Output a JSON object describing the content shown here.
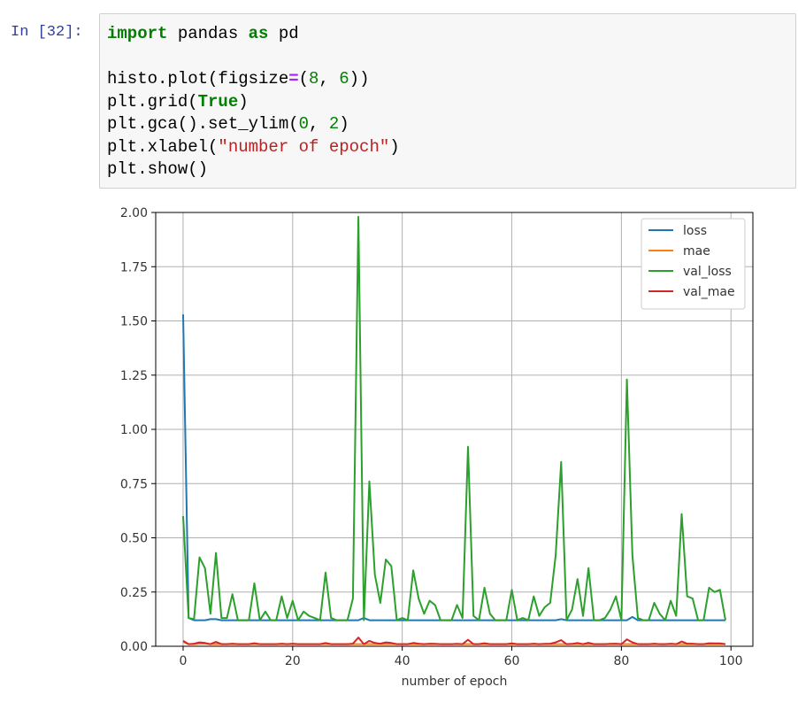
{
  "cell": {
    "prompt": "In [32]:",
    "code": {
      "kw_import": "import",
      "pandas": " pandas ",
      "kw_as": "as",
      "pd": " pd",
      "l3a": "histo.plot(figsize",
      "eq": "=",
      "l3b": "(",
      "n8": "8",
      "l3c": ", ",
      "n6": "6",
      "l3d": "))",
      "l4a": "plt.grid(",
      "true_kw": "True",
      "l4b": ")",
      "l5a": "plt.gca().set_ylim(",
      "n0": "0",
      "l5b": ", ",
      "n2": "2",
      "l5c": ")",
      "l6a": "plt.xlabel(",
      "str_xlabel": "\"number of epoch\"",
      "l6b": ")",
      "l7": "plt.show()"
    }
  },
  "colors": {
    "loss": "#1f77b4",
    "mae": "#ff7f0e",
    "val_loss": "#2ca02c",
    "val_mae": "#d62728",
    "grid": "#b0b0b0"
  },
  "chart_data": {
    "type": "line",
    "xlabel": "number of epoch",
    "ylabel": "",
    "title": "",
    "xlim": [
      -5,
      104
    ],
    "ylim": [
      0,
      2
    ],
    "xticks": [
      0,
      20,
      40,
      60,
      80,
      100
    ],
    "yticks": [
      0.0,
      0.25,
      0.5,
      0.75,
      1.0,
      1.25,
      1.5,
      1.75,
      2.0
    ],
    "ytick_labels": [
      "0.00",
      "0.25",
      "0.50",
      "0.75",
      "1.00",
      "1.25",
      "1.50",
      "1.75",
      "2.00"
    ],
    "grid": true,
    "legend_position": "top-right",
    "x": [
      0,
      1,
      2,
      3,
      4,
      5,
      6,
      7,
      8,
      9,
      10,
      11,
      12,
      13,
      14,
      15,
      16,
      17,
      18,
      19,
      20,
      21,
      22,
      23,
      24,
      25,
      26,
      27,
      28,
      29,
      30,
      31,
      32,
      33,
      34,
      35,
      36,
      37,
      38,
      39,
      40,
      41,
      42,
      43,
      44,
      45,
      46,
      47,
      48,
      49,
      50,
      51,
      52,
      53,
      54,
      55,
      56,
      57,
      58,
      59,
      60,
      61,
      62,
      63,
      64,
      65,
      66,
      67,
      68,
      69,
      70,
      71,
      72,
      73,
      74,
      75,
      76,
      77,
      78,
      79,
      80,
      81,
      82,
      83,
      84,
      85,
      86,
      87,
      88,
      89,
      90,
      91,
      92,
      93,
      94,
      95,
      96,
      97,
      98,
      99
    ],
    "series": [
      {
        "name": "loss",
        "values": [
          1.53,
          0.13,
          0.12,
          0.12,
          0.12,
          0.125,
          0.125,
          0.12,
          0.12,
          0.12,
          0.12,
          0.12,
          0.12,
          0.12,
          0.12,
          0.12,
          0.12,
          0.12,
          0.12,
          0.12,
          0.12,
          0.12,
          0.12,
          0.12,
          0.12,
          0.12,
          0.12,
          0.12,
          0.12,
          0.12,
          0.12,
          0.12,
          0.12,
          0.13,
          0.12,
          0.12,
          0.12,
          0.12,
          0.12,
          0.12,
          0.12,
          0.12,
          0.12,
          0.12,
          0.12,
          0.12,
          0.12,
          0.12,
          0.12,
          0.12,
          0.12,
          0.12,
          0.12,
          0.12,
          0.12,
          0.12,
          0.12,
          0.12,
          0.12,
          0.12,
          0.12,
          0.12,
          0.12,
          0.12,
          0.12,
          0.12,
          0.12,
          0.12,
          0.12,
          0.125,
          0.12,
          0.12,
          0.12,
          0.12,
          0.12,
          0.12,
          0.12,
          0.12,
          0.12,
          0.12,
          0.12,
          0.12,
          0.135,
          0.12,
          0.12,
          0.12,
          0.12,
          0.12,
          0.12,
          0.12,
          0.12,
          0.12,
          0.12,
          0.12,
          0.12,
          0.12,
          0.12,
          0.12,
          0.12,
          0.12
        ]
      },
      {
        "name": "mae",
        "values": [
          0.02,
          0.01,
          0.01,
          0.012,
          0.012,
          0.01,
          0.01,
          0.01,
          0.01,
          0.01,
          0.01,
          0.01,
          0.01,
          0.01,
          0.01,
          0.01,
          0.01,
          0.01,
          0.01,
          0.01,
          0.01,
          0.01,
          0.01,
          0.01,
          0.01,
          0.01,
          0.01,
          0.01,
          0.01,
          0.01,
          0.01,
          0.01,
          0.01,
          0.01,
          0.01,
          0.01,
          0.01,
          0.01,
          0.01,
          0.01,
          0.01,
          0.01,
          0.01,
          0.01,
          0.01,
          0.01,
          0.01,
          0.01,
          0.01,
          0.01,
          0.01,
          0.01,
          0.01,
          0.01,
          0.01,
          0.01,
          0.01,
          0.01,
          0.01,
          0.01,
          0.01,
          0.01,
          0.01,
          0.01,
          0.01,
          0.01,
          0.01,
          0.01,
          0.01,
          0.01,
          0.01,
          0.01,
          0.01,
          0.01,
          0.01,
          0.01,
          0.01,
          0.01,
          0.01,
          0.01,
          0.01,
          0.01,
          0.01,
          0.01,
          0.01,
          0.01,
          0.01,
          0.01,
          0.01,
          0.01,
          0.01,
          0.01,
          0.01,
          0.01,
          0.01,
          0.01,
          0.01,
          0.01,
          0.01,
          0.01
        ]
      },
      {
        "name": "val_loss",
        "values": [
          0.6,
          0.13,
          0.125,
          0.41,
          0.36,
          0.15,
          0.43,
          0.13,
          0.13,
          0.24,
          0.12,
          0.12,
          0.12,
          0.29,
          0.12,
          0.16,
          0.12,
          0.12,
          0.23,
          0.13,
          0.21,
          0.12,
          0.16,
          0.14,
          0.13,
          0.12,
          0.34,
          0.13,
          0.12,
          0.12,
          0.12,
          0.22,
          1.98,
          0.12,
          0.76,
          0.33,
          0.2,
          0.4,
          0.37,
          0.12,
          0.13,
          0.12,
          0.35,
          0.22,
          0.15,
          0.21,
          0.19,
          0.12,
          0.12,
          0.12,
          0.19,
          0.13,
          0.92,
          0.14,
          0.12,
          0.27,
          0.15,
          0.12,
          0.12,
          0.12,
          0.26,
          0.12,
          0.13,
          0.12,
          0.23,
          0.14,
          0.18,
          0.2,
          0.42,
          0.85,
          0.12,
          0.17,
          0.31,
          0.14,
          0.36,
          0.12,
          0.12,
          0.13,
          0.17,
          0.23,
          0.12,
          1.23,
          0.42,
          0.13,
          0.12,
          0.12,
          0.2,
          0.15,
          0.12,
          0.21,
          0.14,
          0.61,
          0.23,
          0.22,
          0.12,
          0.12,
          0.27,
          0.25,
          0.26,
          0.12
        ]
      },
      {
        "name": "val_mae",
        "values": [
          0.025,
          0.01,
          0.012,
          0.018,
          0.015,
          0.01,
          0.02,
          0.01,
          0.01,
          0.012,
          0.01,
          0.01,
          0.01,
          0.014,
          0.01,
          0.01,
          0.01,
          0.01,
          0.012,
          0.01,
          0.012,
          0.01,
          0.01,
          0.01,
          0.01,
          0.01,
          0.015,
          0.01,
          0.01,
          0.01,
          0.01,
          0.012,
          0.04,
          0.01,
          0.025,
          0.015,
          0.012,
          0.018,
          0.015,
          0.01,
          0.01,
          0.01,
          0.015,
          0.012,
          0.01,
          0.012,
          0.011,
          0.01,
          0.01,
          0.01,
          0.011,
          0.01,
          0.03,
          0.01,
          0.01,
          0.014,
          0.01,
          0.01,
          0.01,
          0.01,
          0.013,
          0.01,
          0.01,
          0.01,
          0.012,
          0.01,
          0.011,
          0.012,
          0.018,
          0.028,
          0.01,
          0.011,
          0.015,
          0.01,
          0.016,
          0.01,
          0.01,
          0.01,
          0.011,
          0.012,
          0.01,
          0.032,
          0.018,
          0.01,
          0.01,
          0.01,
          0.012,
          0.01,
          0.01,
          0.012,
          0.01,
          0.022,
          0.012,
          0.012,
          0.01,
          0.01,
          0.014,
          0.013,
          0.013,
          0.01
        ]
      }
    ]
  }
}
